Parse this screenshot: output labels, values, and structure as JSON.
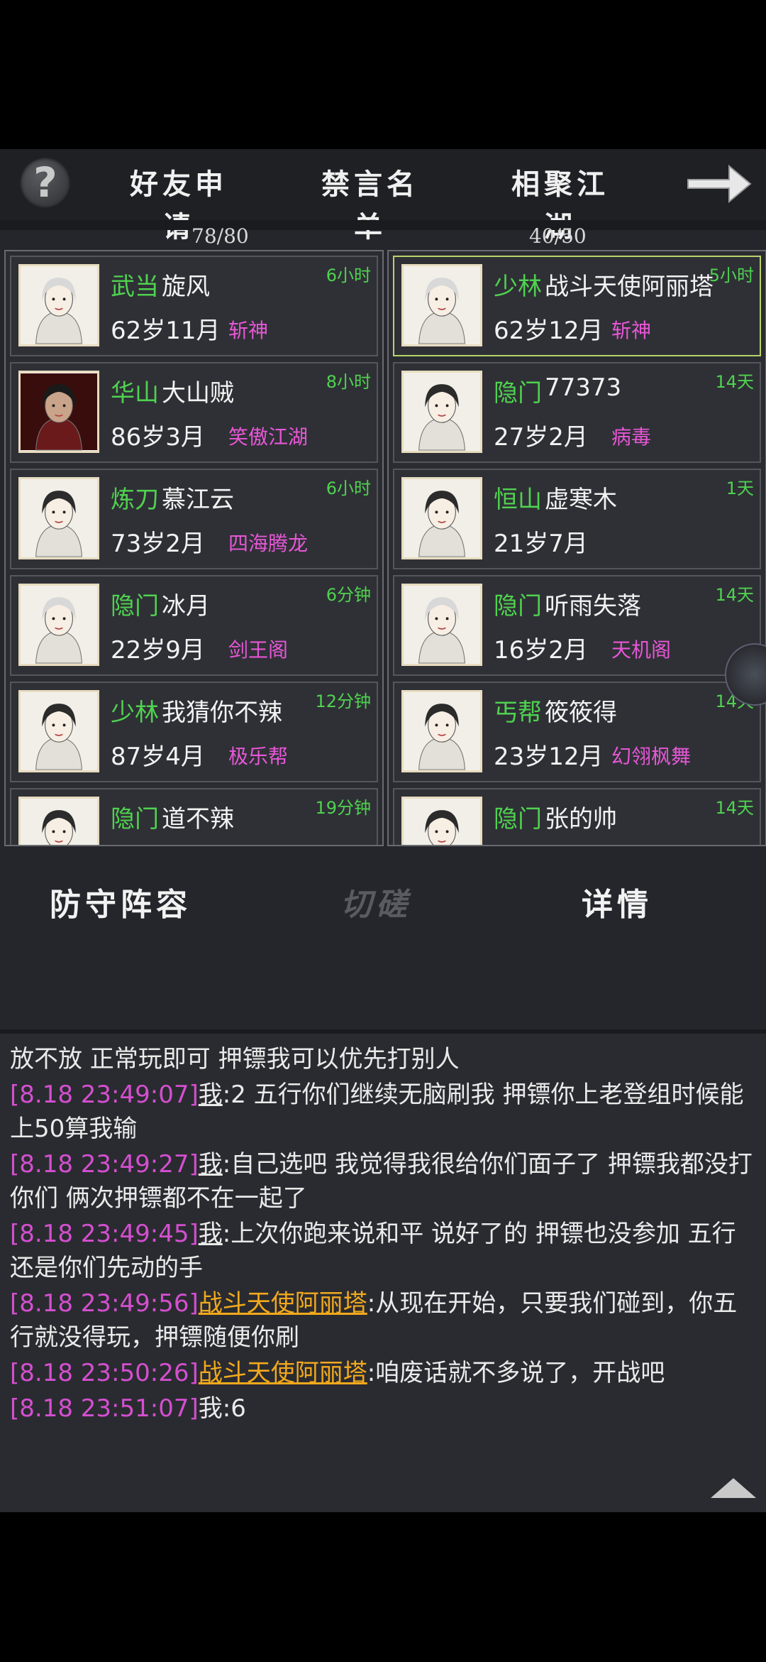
{
  "tabs": [
    "好友申请",
    "禁言名单",
    "相聚江湖"
  ],
  "help_icon": "question-icon",
  "next_icon": "arrow-right-icon",
  "counts": {
    "left": "78/80",
    "right": "40/50"
  },
  "left_list": [
    {
      "sect": "武当",
      "name": "旋风",
      "age": "62岁11月",
      "guild": "斩神",
      "time": "6小时"
    },
    {
      "sect": "华山",
      "name": "大山贼",
      "age": "86岁3月",
      "guild": "笑傲江湖",
      "time": "8小时"
    },
    {
      "sect": "炼刀",
      "name": "慕江云",
      "age": "73岁2月",
      "guild": "四海腾龙",
      "time": "6小时"
    },
    {
      "sect": "隐门",
      "name": "冰月",
      "age": "22岁9月",
      "guild": "剑王阁",
      "time": "6分钟"
    },
    {
      "sect": "少林",
      "name": "我猜你不辣",
      "age": "87岁4月",
      "guild": "极乐帮",
      "time": "12分钟"
    },
    {
      "sect": "隐门",
      "name": "道不辣",
      "age": "",
      "guild": "",
      "time": "19分钟"
    }
  ],
  "right_list": [
    {
      "sect": "少林",
      "name": "战斗天使阿丽塔",
      "age": "62岁12月",
      "guild": "斩神",
      "time": "5小时",
      "selected": true
    },
    {
      "sect": "隐门",
      "name": "77373",
      "age": "27岁2月",
      "guild": "病毒",
      "time": "14天"
    },
    {
      "sect": "恒山",
      "name": "虚寒木",
      "age": "21岁7月",
      "guild": "",
      "time": "1天"
    },
    {
      "sect": "隐门",
      "name": "听雨失落",
      "age": "16岁2月",
      "guild": "天机阁",
      "time": "14天"
    },
    {
      "sect": "丐帮",
      "name": "筱筱得",
      "age": "23岁12月",
      "guild": "幻翎枫舞",
      "time": "14天"
    },
    {
      "sect": "隐门",
      "name": "张的帅",
      "age": "",
      "guild": "",
      "time": "14天"
    }
  ],
  "actions": {
    "defense": "防守阵容",
    "spar": "切磋",
    "detail": "详情"
  },
  "chat": {
    "first_line": "放不放 正常玩即可 押镖我可以优先打别人",
    "messages": [
      {
        "ts": "[8.18 23:49:07]",
        "sender": "我",
        "text": ":2 五行你们继续无脑刷我 押镖你上老登组时候能上50算我输",
        "enemy": false
      },
      {
        "ts": "[8.18 23:49:27]",
        "sender": "我",
        "text": ":自己选吧 我觉得我很给你们面子了 押镖我都没打你们 俩次押镖都不在一起了",
        "enemy": false
      },
      {
        "ts": "[8.18 23:49:45]",
        "sender": "我",
        "text": ":上次你跑来说和平 说好了的 押镖也没参加 五行还是你们先动的手",
        "enemy": false
      },
      {
        "ts": "[8.18 23:49:56]",
        "sender": "战斗天使阿丽塔",
        "text": ":从现在开始，只要我们碰到，你五行就没得玩，押镖随便你刷",
        "enemy": true
      },
      {
        "ts": "[8.18 23:50:26]",
        "sender": "战斗天使阿丽塔",
        "text": ":咱废话就不多说了，开战吧",
        "enemy": true
      },
      {
        "ts": "[8.18 23:51:07]",
        "sender": "我",
        "text": ":6",
        "enemy": false,
        "plain": true
      }
    ]
  },
  "colors": {
    "sect": "#4fd24f",
    "guild": "#e657d6",
    "timestamp": "#d44fd0",
    "enemy": "#f2a91c",
    "selected": "#b7d36a"
  }
}
